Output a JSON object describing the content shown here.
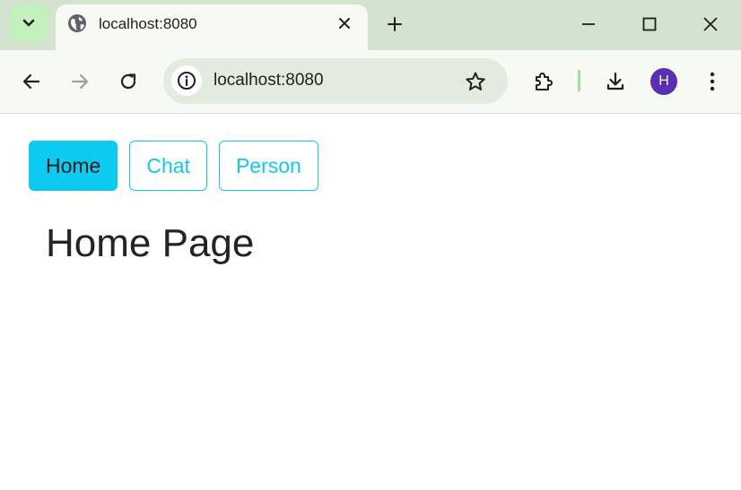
{
  "browser": {
    "tab": {
      "title": "localhost:8080",
      "favicon": "globe-icon"
    },
    "address_bar": {
      "url": "localhost:8080",
      "site_info_icon": "info-icon"
    },
    "profile": {
      "initial": "H",
      "color": "#5a2fb3"
    },
    "icons": {
      "tab_search": "chevron-down-icon",
      "close_tab": "close-icon",
      "new_tab": "plus-icon",
      "minimize": "minimize-icon",
      "maximize": "maximize-icon",
      "close_window": "close-icon",
      "back": "arrow-left-icon",
      "forward": "arrow-right-icon",
      "reload": "reload-icon",
      "bookmark": "star-icon",
      "extensions": "puzzle-icon",
      "downloads": "download-icon",
      "menu": "kebab-menu-icon"
    },
    "colors": {
      "tabstrip": "#d3e3cf",
      "toolbar": "#f7faf4",
      "omnibox": "#e2ebdd"
    }
  },
  "page": {
    "nav": [
      {
        "label": "Home",
        "active": true
      },
      {
        "label": "Chat",
        "active": false
      },
      {
        "label": "Person",
        "active": false
      }
    ],
    "title": "Home Page",
    "accent_color": "#0dcaf0"
  }
}
